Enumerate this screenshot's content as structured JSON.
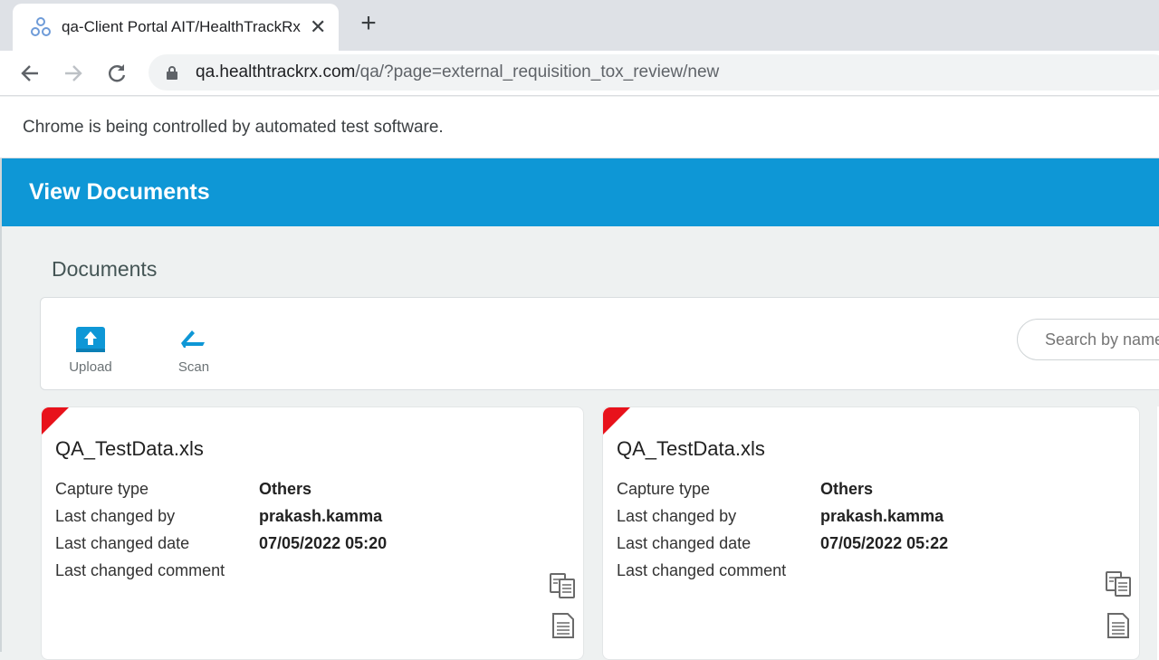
{
  "browser": {
    "tab_title": "qa-Client Portal AIT/HealthTrackRx",
    "url_host": "qa.healthtrackrx.com",
    "url_path": "/qa/?page=external_requisition_tox_review/new",
    "infobar_text": "Chrome is being controlled by automated test software."
  },
  "header": {
    "title": "View Documents"
  },
  "documents": {
    "section_title": "Documents",
    "upload_label": "Upload",
    "scan_label": "Scan",
    "search_placeholder": "Search by name"
  },
  "cards": [
    {
      "title": "QA_TestData.xls",
      "capture_type_label": "Capture type",
      "capture_type": "Others",
      "changed_by_label": "Last changed by",
      "changed_by": "prakash.kamma",
      "changed_date_label": "Last changed date",
      "changed_date": "07/05/2022 05:20",
      "comment_label": "Last changed comment",
      "comment": ""
    },
    {
      "title": "QA_TestData.xls",
      "capture_type_label": "Capture type",
      "capture_type": "Others",
      "changed_by_label": "Last changed by",
      "changed_by": "prakash.kamma",
      "changed_date_label": "Last changed date",
      "changed_date": "07/05/2022 05:22",
      "comment_label": "Last changed comment",
      "comment": ""
    }
  ],
  "colors": {
    "header_bg": "#0e97d6",
    "flag_red": "#e8121b",
    "page_bg": "#eef1f1"
  }
}
